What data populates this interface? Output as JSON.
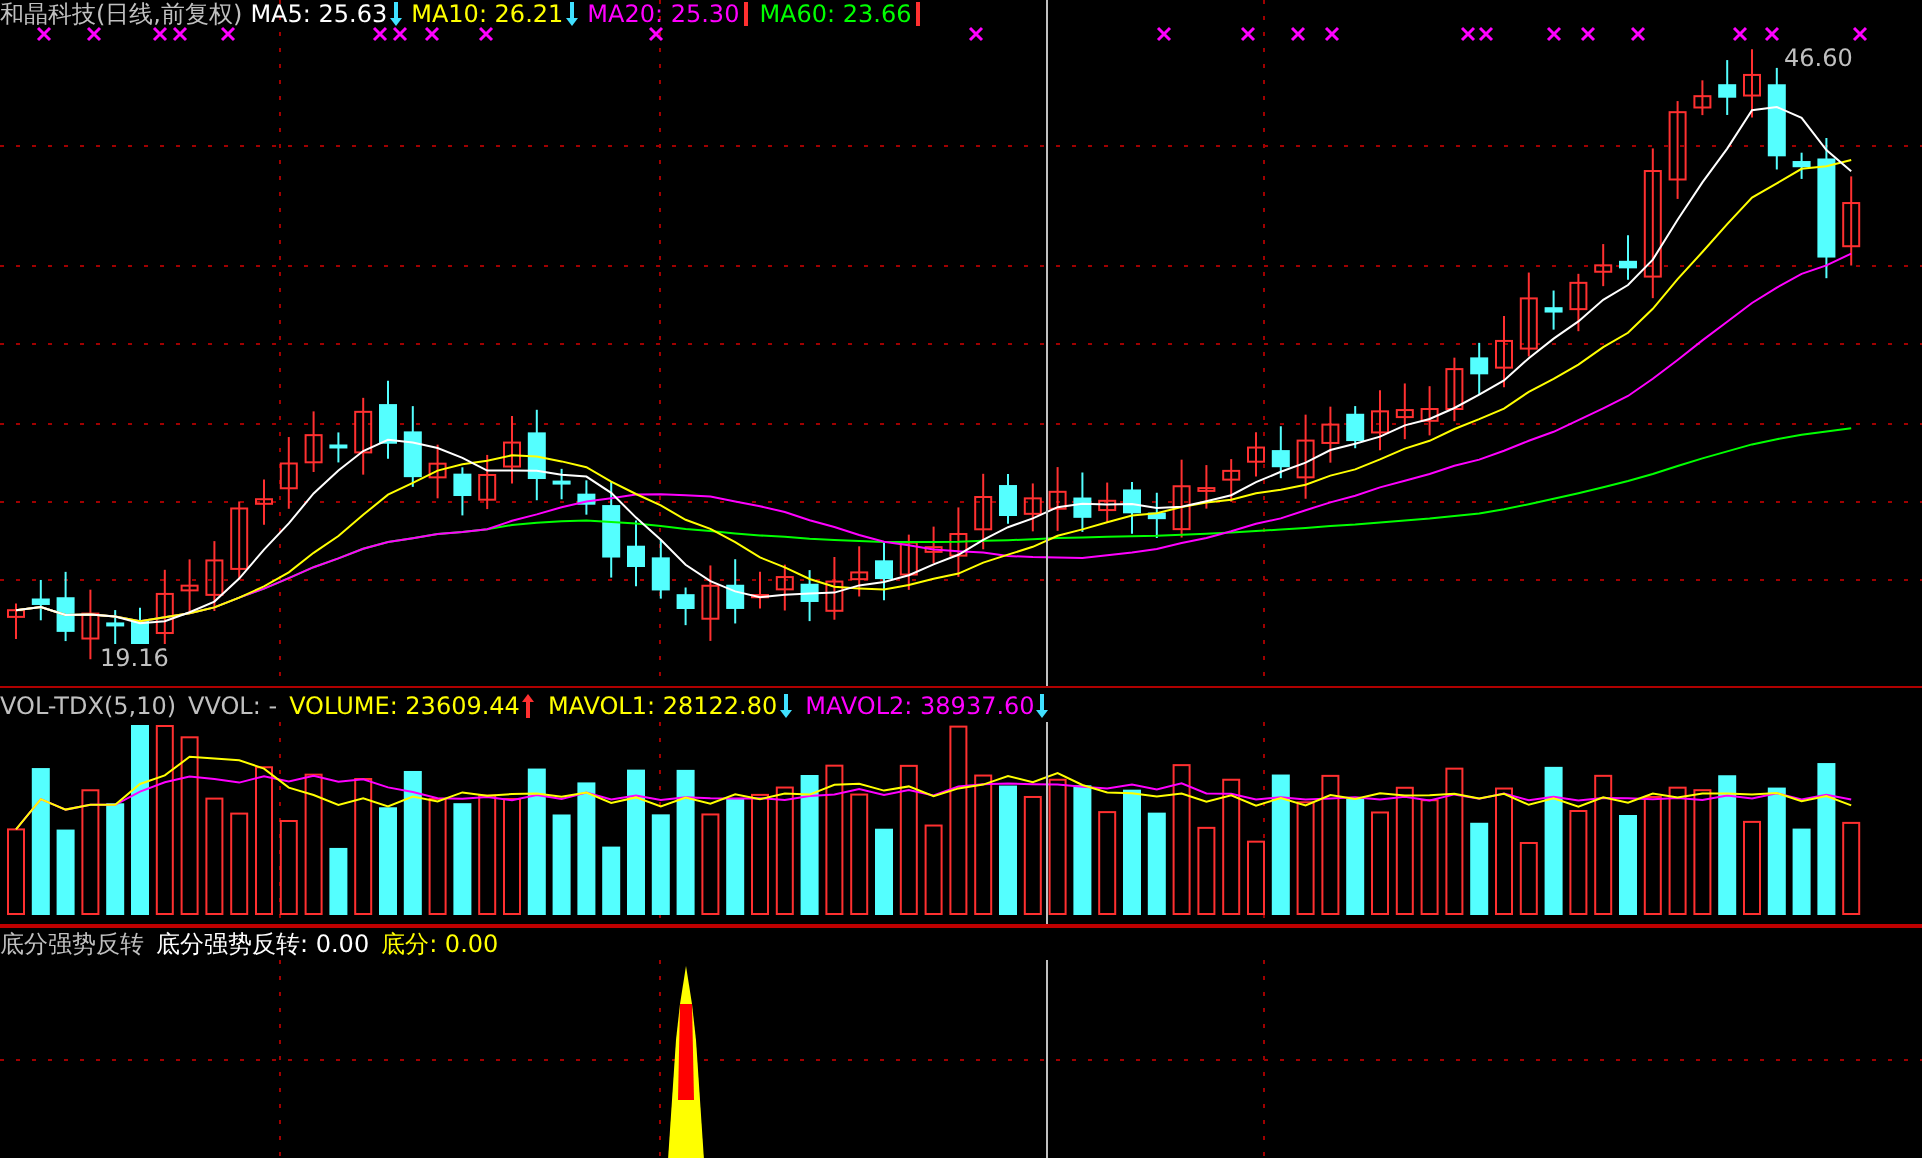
{
  "price_pane": {
    "title": "和晶科技(日线,前复权)",
    "ma_labels": [
      {
        "label": "MA5: 25.63",
        "color": "#ffffff",
        "kind": "down"
      },
      {
        "label": "MA10: 26.21",
        "color": "#ffff00",
        "kind": "down"
      },
      {
        "label": "MA20: 25.30",
        "color": "#ff00ff",
        "kind": "flat"
      },
      {
        "label": "MA60: 23.66",
        "color": "#00ff00",
        "kind": "flat"
      }
    ],
    "high_label": "46.60",
    "low_label": "19.16"
  },
  "volume_pane": {
    "indicator": "VOL-TDX(5,10)",
    "vvol": "VVOL: -",
    "items": [
      {
        "label": "VOLUME: 23609.44",
        "color": "#ffff00",
        "kind": "up"
      },
      {
        "label": "MAVOL1: 28122.80",
        "color": "#ffff00",
        "kind": "down"
      },
      {
        "label": "MAVOL2: 38937.60",
        "color": "#ff00ff",
        "kind": "down"
      }
    ]
  },
  "signal_pane": {
    "name": "底分强势反转",
    "items": [
      {
        "label": "底分强势反转: 0.00",
        "color": "#ffffff"
      },
      {
        "label": "底分: 0.00",
        "color": "#ffff00"
      }
    ]
  }
}
